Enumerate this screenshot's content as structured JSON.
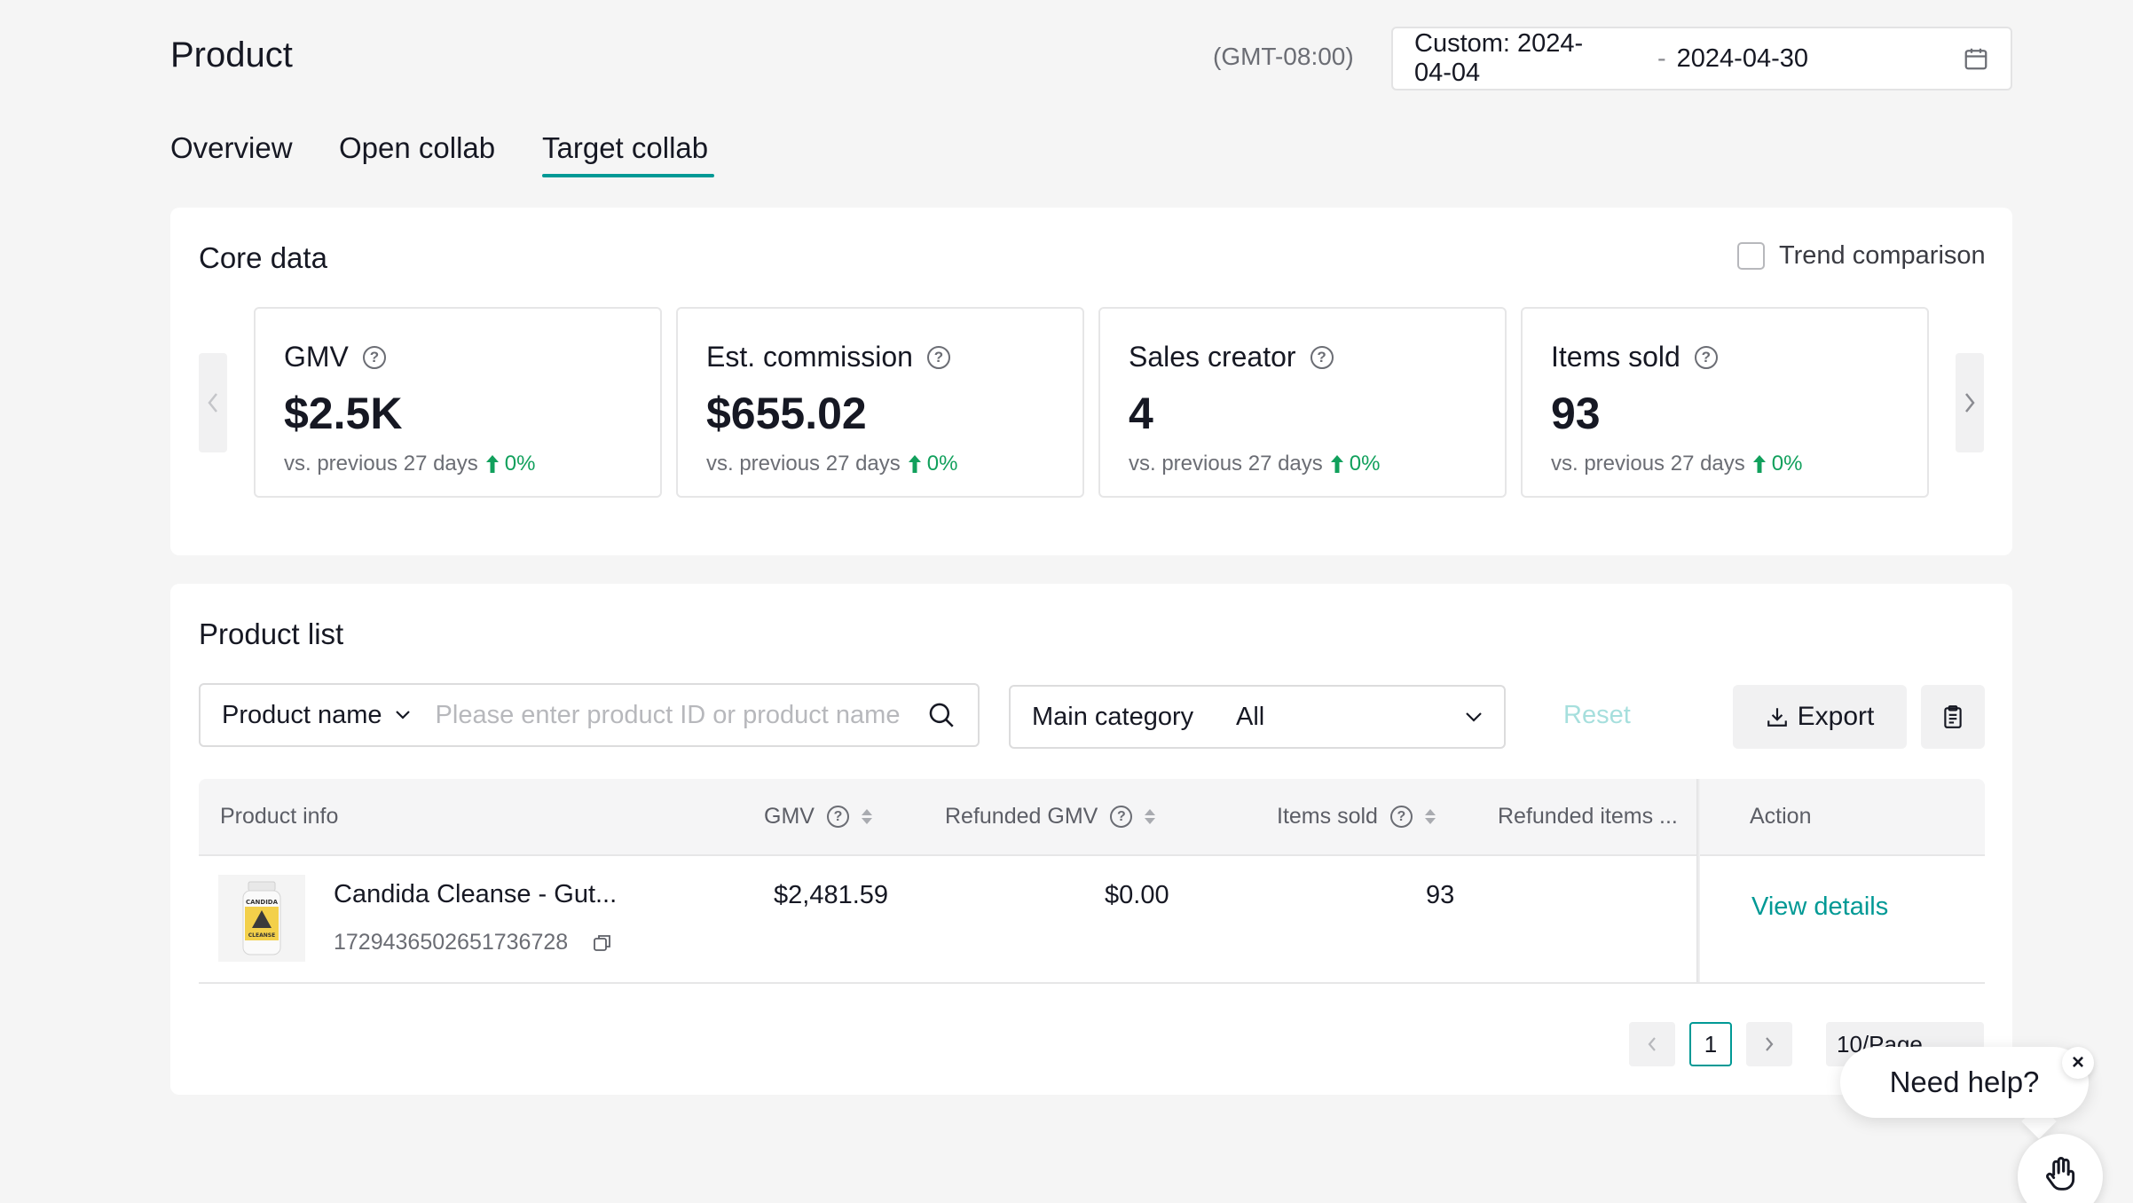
{
  "header": {
    "title": "Product",
    "timezone": "(GMT-08:00)",
    "date_range": {
      "start": "Custom: 2024-04-04",
      "separator": "-",
      "end": "2024-04-30"
    }
  },
  "tabs": [
    {
      "label": "Overview",
      "active": false
    },
    {
      "label": "Open collab",
      "active": false
    },
    {
      "label": "Target collab",
      "active": true
    }
  ],
  "accent_color": "#009995",
  "core_data": {
    "title": "Core data",
    "trend_label": "Trend comparison",
    "trend_checked": false,
    "metrics": [
      {
        "label": "GMV",
        "value": "$2.5K",
        "comparison": "vs. previous 27 days",
        "change": "0%"
      },
      {
        "label": "Est. commission",
        "value": "$655.02",
        "comparison": "vs. previous 27 days",
        "change": "0%"
      },
      {
        "label": "Sales creator",
        "value": "4",
        "comparison": "vs. previous 27 days",
        "change": "0%"
      },
      {
        "label": "Items sold",
        "value": "93",
        "comparison": "vs. previous 27 days",
        "change": "0%"
      }
    ]
  },
  "product_list": {
    "title": "Product list",
    "search": {
      "field_select": "Product name",
      "placeholder": "Please enter product ID or product name"
    },
    "category": {
      "label": "Main category",
      "value": "All"
    },
    "reset_label": "Reset",
    "export_label": "Export",
    "columns": [
      "Product info",
      "GMV",
      "Refunded GMV",
      "Items sold",
      "Refunded items ...",
      "Action"
    ],
    "rows": [
      {
        "name": "Candida Cleanse - Gut...",
        "id": "1729436502651736728",
        "gmv": "$2,481.59",
        "refunded_gmv": "$0.00",
        "items_sold": "93",
        "refunded_items": "",
        "action": "View details"
      }
    ],
    "pagination": {
      "current": "1",
      "page_size": "10/Page"
    }
  },
  "help": {
    "label": "Need help?",
    "close": "×"
  },
  "product_thumb_label": {
    "line1": "CANDIDA",
    "line2": "CLEANSE"
  }
}
